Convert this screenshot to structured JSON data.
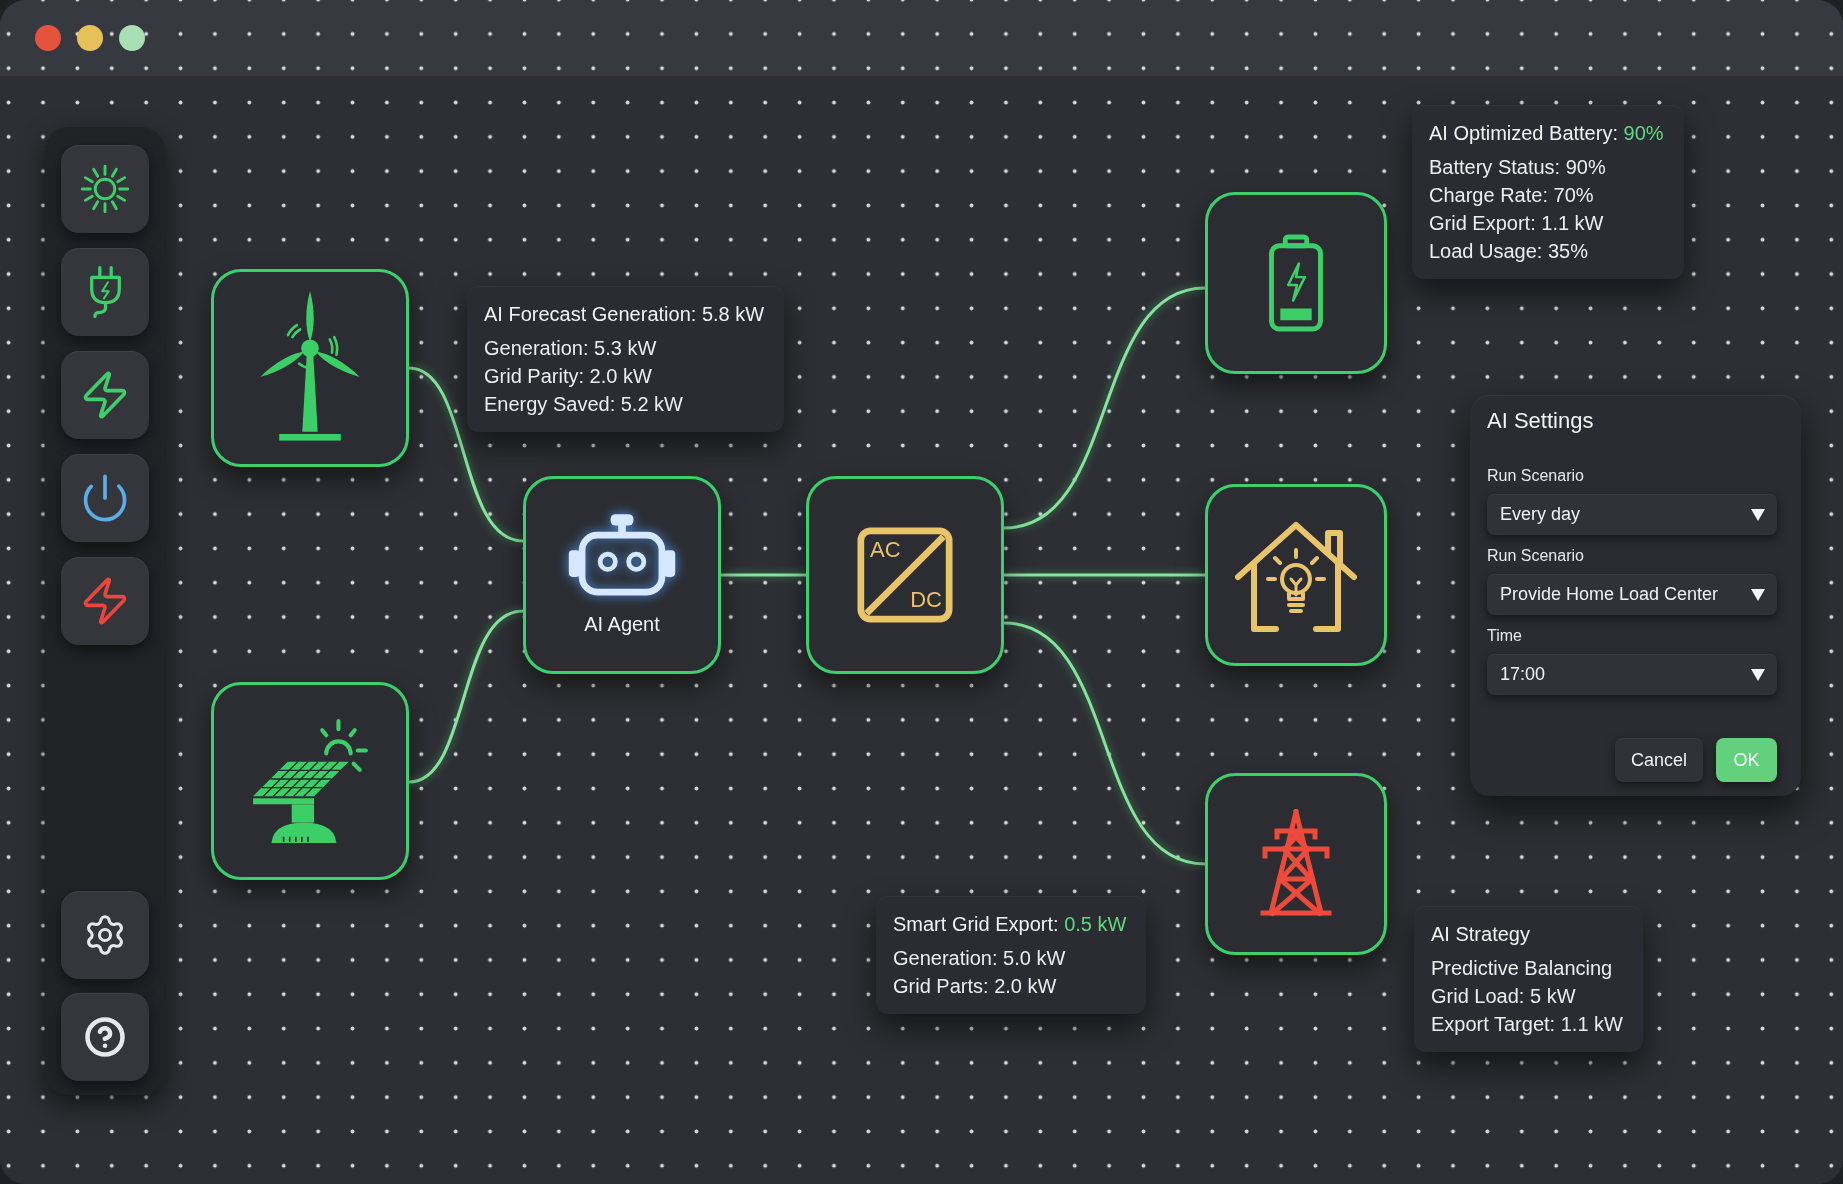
{
  "sidebar": {
    "top_buttons": [
      {
        "kind": "sun",
        "color": "#3ecf6a"
      },
      {
        "kind": "plug",
        "color": "#3ecf6a"
      },
      {
        "kind": "bolt",
        "color": "#3ecf6a"
      },
      {
        "kind": "power",
        "color": "#5aaee8"
      },
      {
        "kind": "bolt",
        "color": "#e8473a"
      }
    ],
    "bottom_buttons": [
      {
        "kind": "settings"
      },
      {
        "kind": "help"
      }
    ]
  },
  "diagram": {
    "nodes": [
      {
        "kind": "wind_turbine",
        "color": "#3ccf68"
      },
      {
        "kind": "solar_panel",
        "color": "#3ccf68"
      },
      {
        "kind": "ai_agent",
        "color": "#d6e8ff",
        "label": "AI Agent"
      },
      {
        "kind": "converter",
        "color": "#e9c46a",
        "labels": [
          "AC",
          "DC"
        ]
      },
      {
        "kind": "battery",
        "color": "#3ccf68"
      },
      {
        "kind": "home",
        "color": "#e9c46a"
      },
      {
        "kind": "grid_tower",
        "color": "#ee4a3b"
      }
    ],
    "info_cards": [
      {
        "title": "AI Forecast Generation: 5.8 kW",
        "lines": [
          "Generation: 5.3 kW",
          "Grid Parity: 2.0 kW",
          "Energy Saved: 5.2 kW"
        ]
      },
      {
        "title": "AI Optimized Battery:",
        "highlight": "90%",
        "lines": [
          "Battery Status: 90%",
          "Charge Rate: 70%",
          "Grid Export: 1.1 kW",
          "Load Usage: 35%"
        ]
      },
      {
        "title": "Smart Grid Export:",
        "highlight": "0.5 kW",
        "lines": [
          "Generation: 5.0 kW",
          "Grid Parts: 2.0 kW"
        ]
      },
      {
        "title": "AI Strategy",
        "lines": [
          "Predictive Balancing",
          "Grid Load: 5 kW",
          "Export Target: 1.1 kW"
        ]
      }
    ]
  },
  "settings_panel": {
    "title": "AI Settings",
    "fields": [
      {
        "label": "Run Scenario",
        "value": "Every day"
      },
      {
        "label": "Run Scenario",
        "value": "Provide Home Load Center"
      },
      {
        "label": "Time",
        "value": "17:00"
      }
    ],
    "buttons": [
      {
        "label": "Cancel",
        "kind": "cancel"
      },
      {
        "label": "OK",
        "kind": "confirm"
      }
    ]
  }
}
